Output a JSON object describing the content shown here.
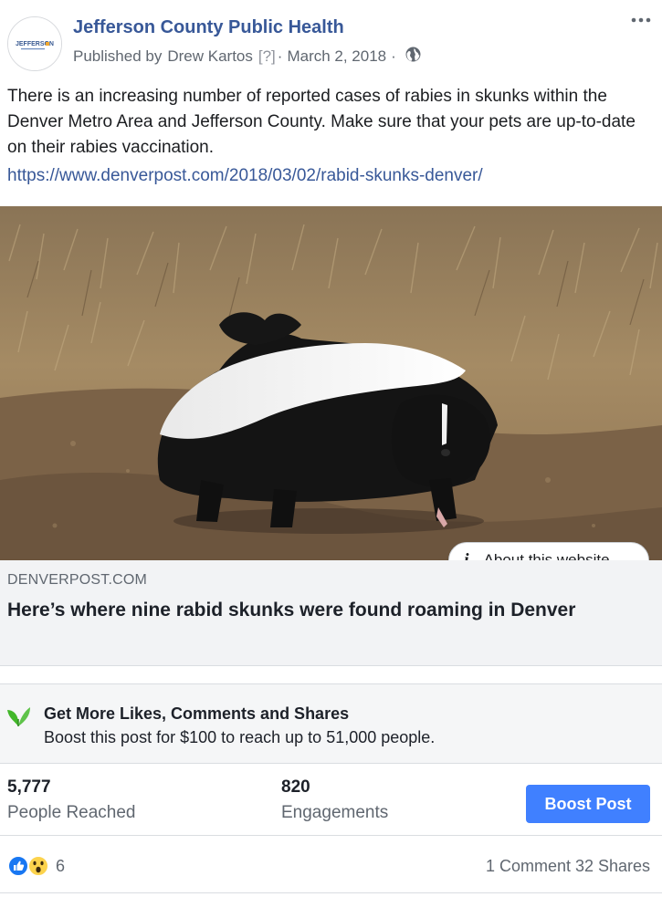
{
  "header": {
    "page_name": "Jefferson County Public Health",
    "published_prefix": "Published by",
    "author": "Drew Kartos",
    "help_marker": "[?]",
    "separator": "·",
    "date": "March 2, 2018",
    "avatar_logo_text": "JEFFERSON",
    "more_icon": "more-dots-icon",
    "privacy_icon": "globe-icon"
  },
  "post": {
    "text": "There is an increasing number of reported cases of rabies in skunks within the Denver Metro Area and Jefferson County. Make sure that your pets are up-to-date on their rabies vaccination.",
    "link": "https://www.denverpost.com/2018/03/02/rabid-skunks-denver/"
  },
  "attachment": {
    "about_label": "About this website",
    "about_icon": "info-icon",
    "domain": "DENVERPOST.COM",
    "title": "Here’s where nine rabid skunks were found roaming in Denver"
  },
  "boost_banner": {
    "icon": "leaf-icon",
    "title": "Get More Likes, Comments and Shares",
    "subtitle": "Boost this post for $100 to reach up to 51,000 people."
  },
  "insights": {
    "reached_value": "5,777",
    "reached_label": "People Reached",
    "engagements_value": "820",
    "engagements_label": "Engagements",
    "boost_button": "Boost Post"
  },
  "footer": {
    "reaction_count": "6",
    "comments": "1 Comment",
    "shares": "32 Shares"
  },
  "colors": {
    "link_blue": "#385898",
    "button_blue": "#4080ff",
    "secondary_text": "#606770"
  }
}
